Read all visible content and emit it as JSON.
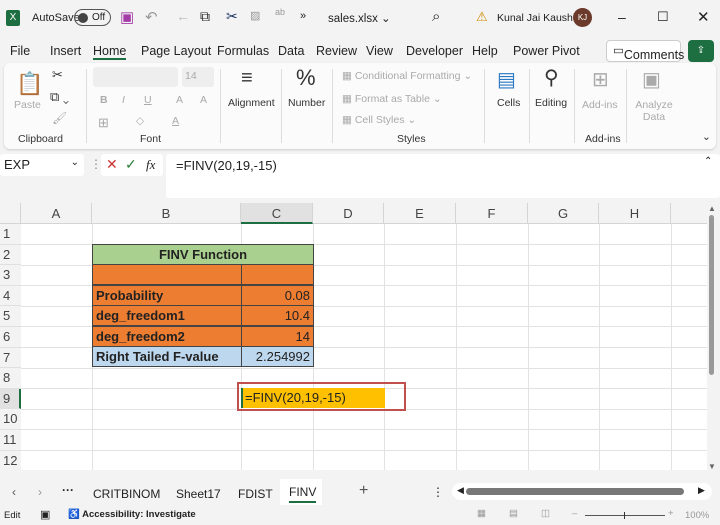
{
  "titlebar": {
    "autosave_label": "AutoSave",
    "autosave_state": "Off",
    "filename": "sales.xlsx",
    "user": "Kunal Jai Kaushik",
    "avatar_initials": "KJ"
  },
  "menu": {
    "items": [
      "File",
      "Insert",
      "Home",
      "Page Layout",
      "Formulas",
      "Data",
      "Review",
      "View",
      "Developer",
      "Help",
      "Power Pivot"
    ],
    "active": "Home",
    "comments": "Comments"
  },
  "ribbon": {
    "paste": "Paste",
    "clipboard": "Clipboard",
    "font_size": "14",
    "font": "Font",
    "font_buttons": [
      "B",
      "I",
      "U",
      "A",
      "A"
    ],
    "alignment": "Alignment",
    "number": "Number",
    "conditional": "Conditional Formatting",
    "format_table": "Format as Table",
    "cell_styles": "Cell Styles",
    "styles": "Styles",
    "cells": "Cells",
    "editing": "Editing",
    "addins": "Add-ins",
    "addins_group": "Add-ins",
    "analyze": "Analyze Data"
  },
  "formula_bar": {
    "name_box": "EXP",
    "formula": "=FINV(20,19,-15)",
    "fx": "fx"
  },
  "sheet": {
    "columns": [
      "A",
      "B",
      "C",
      "D",
      "E",
      "F",
      "G",
      "H"
    ],
    "rows": [
      "1",
      "2",
      "3",
      "4",
      "5",
      "6",
      "7",
      "8",
      "9",
      "10",
      "11",
      "12"
    ],
    "title": "FINV Function",
    "table": [
      {
        "label": "Probability",
        "value": "0.08"
      },
      {
        "label": "deg_freedom1",
        "value": "10.4"
      },
      {
        "label": "deg_freedom2",
        "value": "14"
      },
      {
        "label": "Right Tailed F-value",
        "value": "2.254992"
      }
    ],
    "active_cell_text": "=FINV(20,19,-15)",
    "colors": {
      "header_green": "#a9d08e",
      "orange": "#ed7d31",
      "blue": "#bdd7ee",
      "yellow": "#ffc000",
      "highlight_red": "#c0504d"
    }
  },
  "tabs": {
    "sheets": [
      "CRITBINOM",
      "Sheet17",
      "FDIST",
      "FINV"
    ],
    "active": "FINV",
    "add": "+"
  },
  "status": {
    "mode": "Edit",
    "accessibility": "Accessibility: Investigate",
    "zoom": "100%"
  }
}
